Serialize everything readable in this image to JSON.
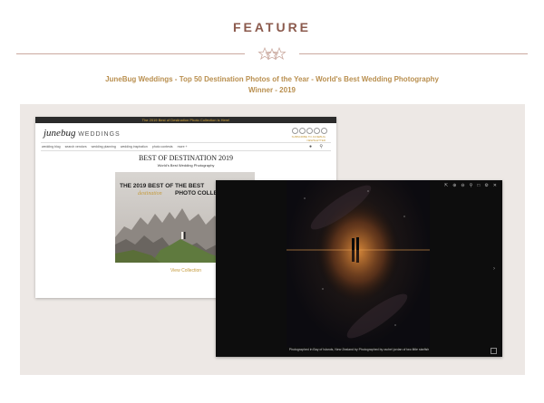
{
  "header": {
    "title": "FEATURE",
    "subtitle_line1": "JuneBug Weddings - Top 50 Destination Photos of the Year - World's Best Wedding Photography",
    "subtitle_line2": "Winner - 2019"
  },
  "screenshot_site": {
    "banner": "The 2019 Best of Destination Photo Collection is Here!",
    "logo_script": "junebug",
    "logo_caps": "WEDDINGS",
    "subscribe_text": "SUBSCRIBE TO JUNEBUG NEWSLETTER",
    "nav": [
      "wedding blog",
      "search vendors",
      "wedding planning",
      "wedding inspiration",
      "photo contests",
      "more +"
    ],
    "heading": "BEST OF DESTINATION 2019",
    "subheading": "World's Best Wedding Photography",
    "promo_line1": "THE 2019 BEST OF THE BEST",
    "promo_destination": "destination",
    "promo_line2": "PHOTO COLLECTION",
    "view_link": "View Collection"
  },
  "screenshot_lightbox": {
    "controls": [
      "share",
      "zoom-in",
      "zoom-out",
      "search",
      "fullscreen",
      "settings",
      "close"
    ],
    "caption": "Photographed in Bay of Islands, New Zealand by Photographed by rachel jordan of two little starfish"
  },
  "colors": {
    "title": "#8b5a4d",
    "accent_gold": "#b98f4f",
    "panel_bg": "#ede8e5"
  }
}
